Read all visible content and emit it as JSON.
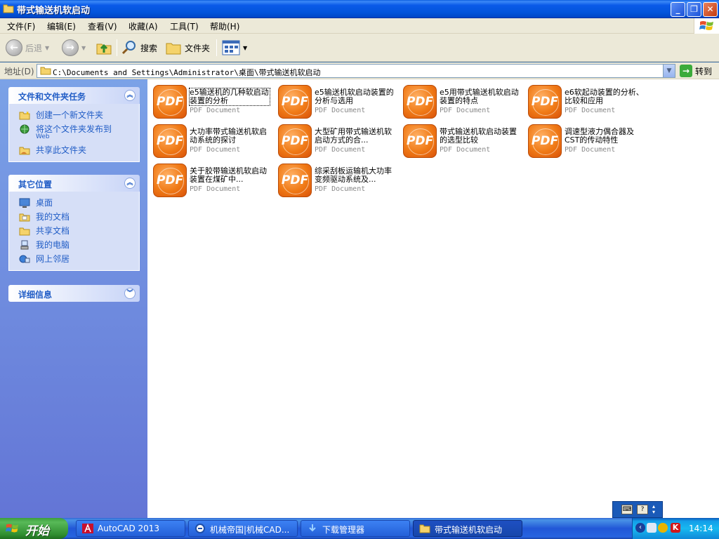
{
  "window": {
    "title": "带式输送机软启动"
  },
  "menu": [
    "文件(F)",
    "编辑(E)",
    "查看(V)",
    "收藏(A)",
    "工具(T)",
    "帮助(H)"
  ],
  "toolbar": {
    "back": "后退",
    "search": "搜索",
    "folders": "文件夹"
  },
  "address": {
    "label": "地址(D)",
    "path": "C:\\Documents and Settings\\Administrator\\桌面\\带式输送机软启动",
    "go": "转到"
  },
  "sidebar": {
    "tasks": {
      "title": "文件和文件夹任务",
      "items": [
        {
          "label": "创建一个新文件夹",
          "icon": "new-folder-icon"
        },
        {
          "label": "将这个文件夹发布到",
          "sub": "Web",
          "icon": "publish-web-icon"
        },
        {
          "label": "共享此文件夹",
          "icon": "share-folder-icon"
        }
      ]
    },
    "places": {
      "title": "其它位置",
      "items": [
        {
          "label": "桌面",
          "icon": "desktop-icon"
        },
        {
          "label": "我的文档",
          "icon": "my-documents-icon"
        },
        {
          "label": "共享文档",
          "icon": "shared-documents-icon"
        },
        {
          "label": "我的电脑",
          "icon": "my-computer-icon"
        },
        {
          "label": "网上邻居",
          "icon": "network-places-icon"
        }
      ]
    },
    "details": {
      "title": "详细信息"
    }
  },
  "files": [
    {
      "name": "e5输送机的几种软启动装置的分析",
      "type": "PDF Document"
    },
    {
      "name": "e5输送机软启动装置的分析与选用",
      "type": "PDF Document"
    },
    {
      "name": "e5用带式输送机软启动装置的特点",
      "type": "PDF Document"
    },
    {
      "name": "e6软起动装置的分析、比较和应用",
      "type": "PDF Document"
    },
    {
      "name": "大功率带式输送机软启动系统的探讨",
      "type": "PDF Document"
    },
    {
      "name": "大型矿用带式输送机软启动方式的合...",
      "type": "PDF Document"
    },
    {
      "name": "带式输送机软启动装置的选型比较",
      "type": "PDF Document"
    },
    {
      "name": "调速型液力偶合器及CST的传动特性",
      "type": "PDF Document"
    },
    {
      "name": "关于胶带输送机软启动装置在煤矿中...",
      "type": "PDF Document"
    },
    {
      "name": "综采刮板运输机大功率变频驱动系统及...",
      "type": "PDF Document"
    }
  ],
  "pdf_icon_text": "PDF",
  "taskbar": {
    "start": "开始",
    "tasks": [
      {
        "label": "AutoCAD 2013",
        "icon": "autocad-icon"
      },
      {
        "label": "机械帝国|机械CAD...",
        "icon": "browser-icon"
      },
      {
        "label": "下载管理器",
        "icon": "download-icon"
      },
      {
        "label": "带式输送机软启动",
        "icon": "folder-icon",
        "active": true
      }
    ],
    "clock": "14:14"
  },
  "colors": {
    "titlebar": "#0355dc",
    "sidebar_link": "#215dc6",
    "pdf_orange": "#f07a16",
    "start_green": "#3c9d3c"
  }
}
